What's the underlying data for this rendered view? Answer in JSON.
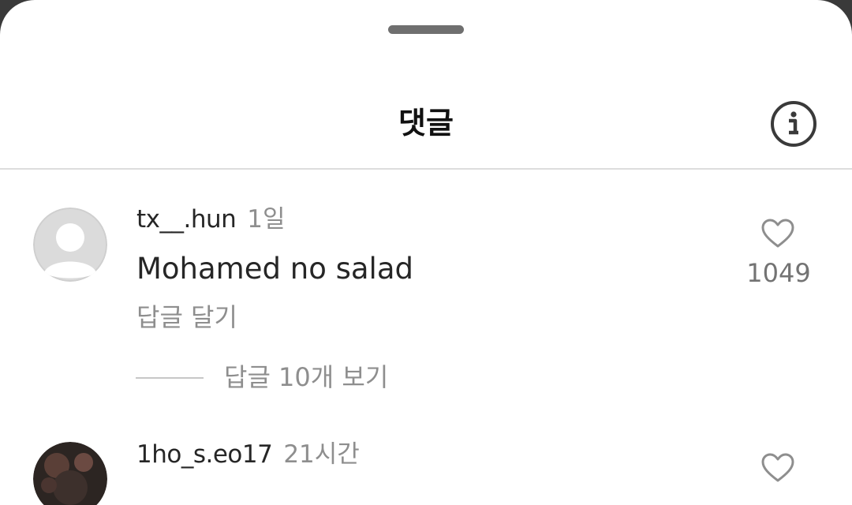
{
  "sheet": {
    "title": "댓글"
  },
  "icons": {
    "info": "info-circle-icon",
    "like": "heart-outline-icon",
    "default_avatar": "default-profile-avatar"
  },
  "comments": [
    {
      "username": "tx__.hun",
      "time": "1일",
      "text": "Mohamed no salad",
      "reply_label": "답글 달기",
      "likes": "1049",
      "view_replies_label": "답글 10개 보기"
    },
    {
      "username": "1ho_s.eo17",
      "time": "21시간"
    }
  ],
  "colors": {
    "text_primary": "#262626",
    "text_secondary": "#8e8e8e",
    "handle": "#6f6f6f",
    "divider": "#dddddd"
  }
}
